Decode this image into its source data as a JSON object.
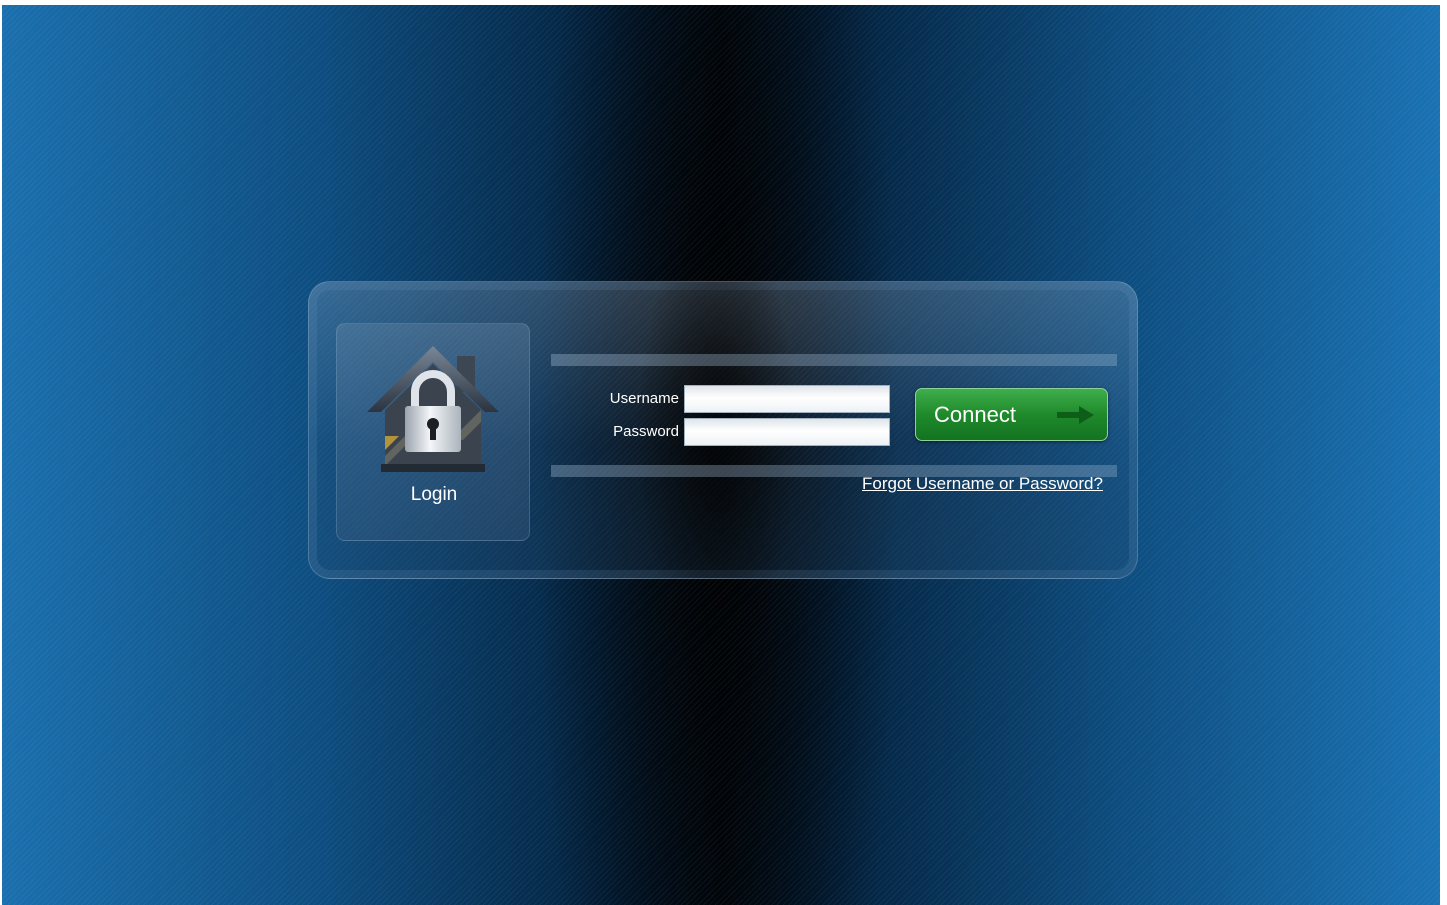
{
  "login_tile": {
    "icon": "house-lock-icon",
    "label": "Login"
  },
  "form": {
    "username_label": "Username",
    "password_label": "Password",
    "username_value": "",
    "password_value": ""
  },
  "connect_button": {
    "label": "Connect",
    "icon": "arrow-right-icon"
  },
  "forgot_link": "Forgot Username or Password?",
  "colors": {
    "background_blue": "#1a6fae",
    "button_green": "#1f8a2b",
    "text": "#ffffff"
  }
}
